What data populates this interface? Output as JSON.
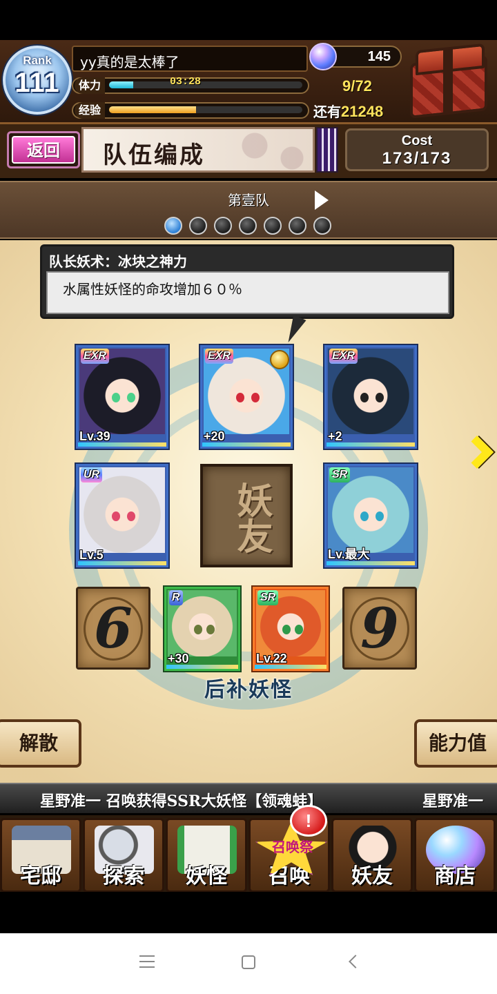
{
  "header": {
    "rank_label": "Rank",
    "rank_value": "111",
    "player_name": "yy真的是太棒了",
    "stamina_label": "体力",
    "stamina_timer": "03:28",
    "stamina_count": "9/72",
    "stamina_fill_fraction": 0.125,
    "exp_label": "经验",
    "exp_fill_fraction": 0.45,
    "gems": "145",
    "remaining_label": "还有",
    "remaining_value": "21248"
  },
  "titlebar": {
    "back_label": "返回",
    "title": "队伍编成",
    "cost_label": "Cost",
    "cost_value": "173/173"
  },
  "team": {
    "name": "第壹队",
    "page_count": 7,
    "active_index": 0
  },
  "leader_skill": {
    "title": "队长妖术：冰块之神力",
    "description": "水属性妖怪的命攻增加６０％"
  },
  "cards": [
    {
      "rarity": "EXR",
      "level": "Lv.39",
      "hair": "#1c1c28",
      "eyes": "#4bd08a"
    },
    {
      "rarity": "EXR",
      "level": "+20",
      "hair": "#efe6dc",
      "eyes": "#d42a3a"
    },
    {
      "rarity": "EXR",
      "level": "+2",
      "hair": "#1c2a3a",
      "eyes": "#222222"
    },
    {
      "rarity": "UR",
      "level": "Lv.5",
      "hair": "#d8d4d4",
      "eyes": "#e0486a"
    },
    {
      "rarity": "SR",
      "level": "Lv.最大",
      "hair": "#8fd0d8",
      "eyes": "#2ea8c8"
    }
  ],
  "friend_slot_label": "妖友",
  "reserve": {
    "label": "后补妖怪",
    "slot_left_number": "6",
    "slot_right_number": "9",
    "cards": [
      {
        "rarity": "R",
        "level": "+30",
        "hair": "#e4d2b0",
        "eyes": "#6a7a3a"
      },
      {
        "rarity": "SR",
        "level": "Lv.22",
        "hair": "#e05a2a",
        "eyes": "#2e9a4a"
      }
    ]
  },
  "buttons": {
    "disband": "解散",
    "stats": "能力值"
  },
  "ticker": {
    "message": "星野准一 召唤获得SSR大妖怪【领魂蛙】",
    "message_repeat": "星野准一"
  },
  "nav": {
    "items": [
      "宅邸",
      "探索",
      "妖怪",
      "召唤",
      "妖友",
      "商店"
    ],
    "summon_badge": "!",
    "summon_tag": "召唤祭"
  },
  "colors": {
    "accent_pink": "#c23193",
    "stamina": "#1fb7d6",
    "exp": "#f0a020",
    "highlight_yellow": "#ffe35c"
  }
}
